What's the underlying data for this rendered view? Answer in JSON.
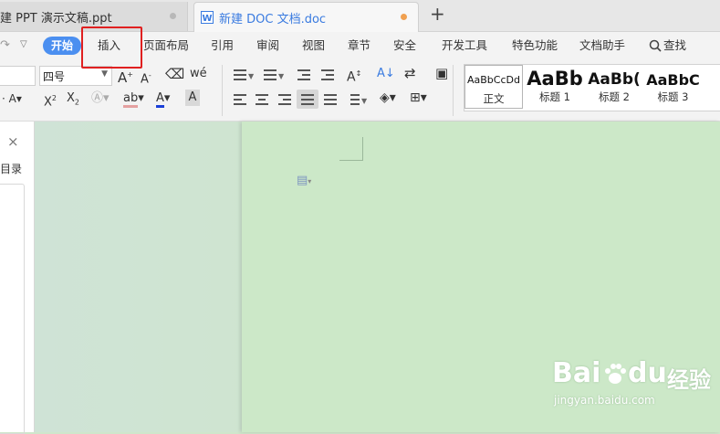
{
  "tabs": [
    {
      "label": "建 PPT 演示文稿.ppt"
    },
    {
      "label": "新建 DOC 文档.doc"
    }
  ],
  "new_tab_symbol": "+",
  "menu": {
    "start": "开始",
    "insert": "插入",
    "page_layout": "页面布局",
    "references": "引用",
    "review": "审阅",
    "view": "视图",
    "section": "章节",
    "security": "安全",
    "dev_tools": "开发工具",
    "features": "特色功能",
    "doc_assistant": "文档助手",
    "search": "查找"
  },
  "toolbar": {
    "font_size": "四号"
  },
  "styles": [
    {
      "preview": "AaBbCcDd",
      "name": "正文"
    },
    {
      "preview": "AaBb",
      "name": "标题 1"
    },
    {
      "preview": "AaBb(",
      "name": "标题 2"
    },
    {
      "preview": "AaBbC",
      "name": "标题 3"
    }
  ],
  "nav": {
    "toc_label": "目录"
  },
  "watermark": {
    "brand": "Bai",
    "brand2": "du",
    "cn": "经验",
    "url": "jingyan.baidu.com"
  },
  "colors": {
    "accent": "#4b8ff0",
    "highlight": "#e02020",
    "doc_background": "#cce8c8",
    "modified_dot": "#f0a050"
  }
}
